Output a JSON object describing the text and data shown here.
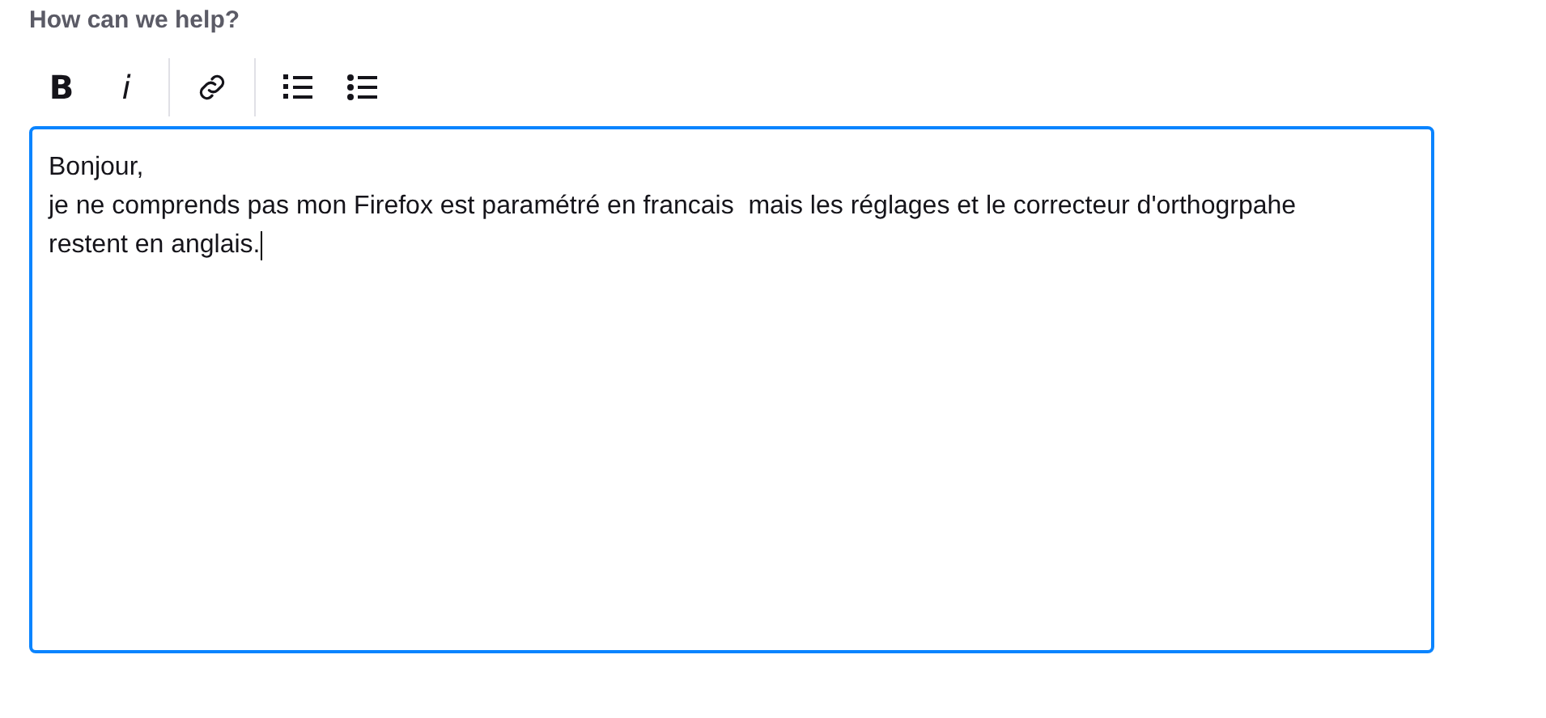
{
  "label": "How can we help?",
  "toolbar": [
    {
      "kind": "bold",
      "text": "B"
    },
    {
      "kind": "italic",
      "text": "i"
    },
    {
      "kind": "divider"
    },
    {
      "kind": "link"
    },
    {
      "kind": "divider"
    },
    {
      "kind": "ordered-list"
    },
    {
      "kind": "bullet-list"
    }
  ],
  "editor": {
    "focused": true,
    "lines": [
      "Bonjour,",
      "je ne comprends pas mon Firefox est paramétré en francais  mais les réglages et le correcteur d'orthogrpahe",
      "restent en anglais."
    ]
  }
}
